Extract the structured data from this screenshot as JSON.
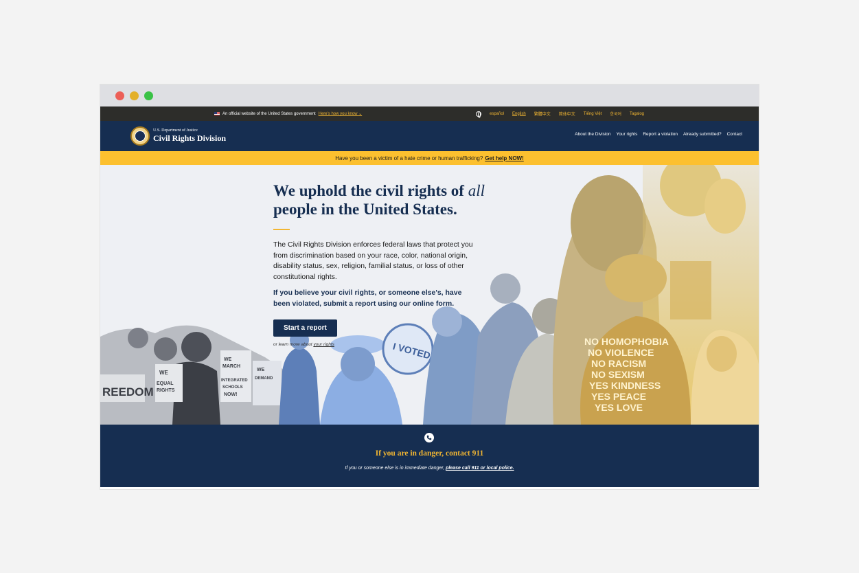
{
  "banner": {
    "official_text": "An official website of the United States government",
    "how_link": "Here's how you know",
    "chevron": "⌄",
    "languages": [
      "español",
      "English",
      "繁體中文",
      "简体中文",
      "Tiếng Việt",
      "한국어",
      "Tagalog"
    ],
    "active_language": "English"
  },
  "header": {
    "agency": "U.S. Department of Justice",
    "title": "Civil Rights Division",
    "nav": [
      "About the Division",
      "Your rights",
      "Report a violation",
      "Already submitted?",
      "Contact"
    ]
  },
  "alert": {
    "text": "Have you been a victim of a hate crime or human trafficking?",
    "link": "Get help NOW!"
  },
  "hero": {
    "title_part1": "We uphold the civil rights of ",
    "title_em": "all",
    "title_part2": "people in the United States.",
    "body": "The Civil Rights Division enforces federal laws that protect you from discrimination based on your race, color, national origin, disability status, sex, religion, familial status, or loss of other constitutional rights.",
    "cta_text": "If you believe your civil rights, or someone else's, have been violated, submit a report using our online form.",
    "button": "Start a report",
    "learn_prefix": "or learn more about ",
    "learn_link": "your rights"
  },
  "collage": {
    "signs": [
      "FREEDOM",
      "WE DEMAND EQUAL RIGHTS NOW!",
      "WE MARCH FOR INTEGRATED SCHOOLS NOW!",
      "WE DEMAND DECENT HOUSING",
      "I VOTED"
    ],
    "shirt_lines": [
      "NO HOMOPHOBIA",
      "NO VIOLENCE",
      "NO RACISM",
      "NO SEXISM",
      "YES KINDNESS",
      "YES PEACE",
      "YES LOVE"
    ]
  },
  "danger": {
    "title": "If you are in danger, contact 911",
    "text_prefix": "If you or someone else is in immediate danger, ",
    "text_link": "please call 911 or local police."
  },
  "colors": {
    "navy": "#162e51",
    "gold": "#f2b632",
    "alert_yellow": "#fcc02f",
    "banner_dark": "#2d2d2a",
    "blue_tint": "#7fa3dd",
    "gold_tint": "#e9c96a"
  },
  "icons": [
    "flag-icon",
    "globe-icon",
    "doj-seal-icon",
    "phone-icon"
  ]
}
